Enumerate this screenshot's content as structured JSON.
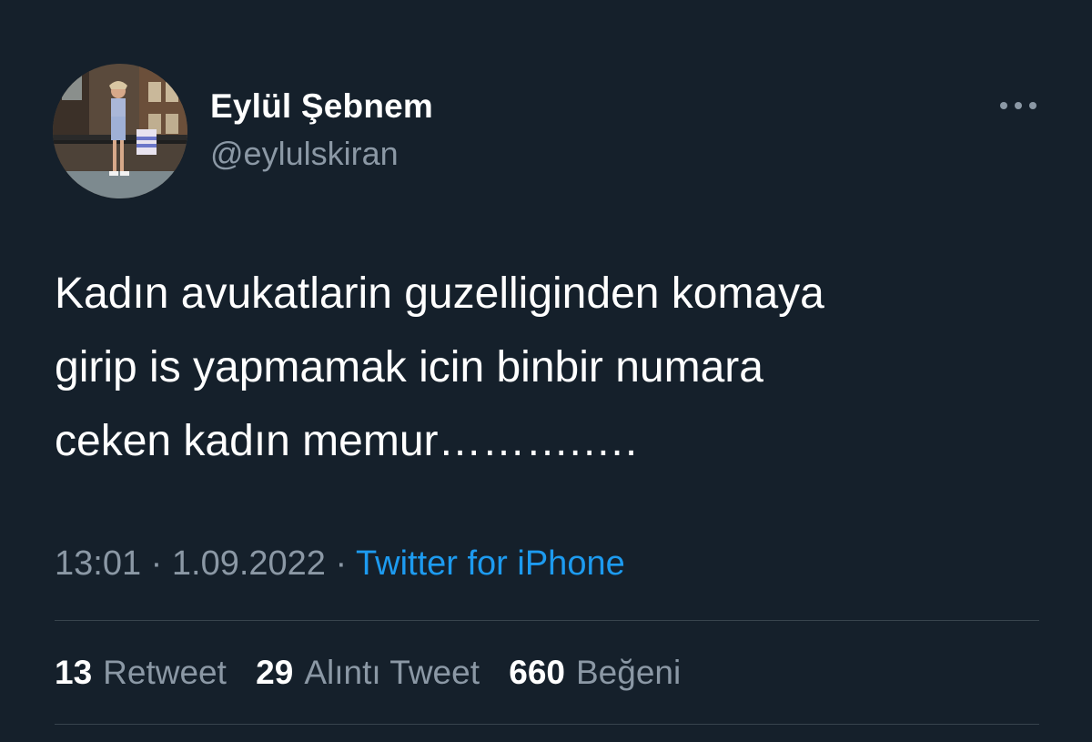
{
  "user": {
    "display_name": "Eylül Şebnem",
    "handle": "@eylulskiran"
  },
  "more_icon": "more-horizontal-icon",
  "tweet": {
    "lines": [
      "Kadın avukatlarin guzelliginden komaya",
      "girip is yapmamak icin binbir numara",
      "ceken kadın memur……….…."
    ]
  },
  "meta": {
    "time": "13:01",
    "separator": "·",
    "date": "1.09.2022",
    "source": "Twitter for iPhone"
  },
  "stats": {
    "retweets_count": "13",
    "retweets_label": "Retweet",
    "quotes_count": "29",
    "quotes_label": "Alıntı Tweet",
    "likes_count": "660",
    "likes_label": "Beğeni"
  },
  "colors": {
    "background": "#15202b",
    "primary_text": "#ffffff",
    "secondary_text": "#8b98a5",
    "accent": "#1d9bf0",
    "divider": "#38444d"
  }
}
